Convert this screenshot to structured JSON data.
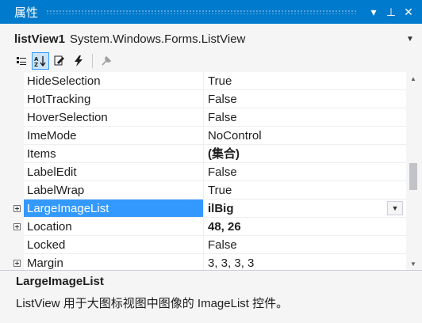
{
  "panel": {
    "title": "属性",
    "pin_glyph": "▾",
    "autohide_glyph": "⊥",
    "close_glyph": "✕"
  },
  "object_selector": {
    "name": "listView1",
    "type": "System.Windows.Forms.ListView"
  },
  "toolbar": {
    "icons": [
      "categorized-icon",
      "alphabetical-icon",
      "properties-icon",
      "events-icon",
      "property-pages-icon"
    ],
    "active": "alphabetical-icon"
  },
  "grid": {
    "rows": [
      {
        "name": "HideSelection",
        "value": "True",
        "bold": false,
        "expandable": false
      },
      {
        "name": "HotTracking",
        "value": "False",
        "bold": false,
        "expandable": false
      },
      {
        "name": "HoverSelection",
        "value": "False",
        "bold": false,
        "expandable": false
      },
      {
        "name": "ImeMode",
        "value": "NoControl",
        "bold": false,
        "expandable": false
      },
      {
        "name": "Items",
        "value": "(集合)",
        "bold": true,
        "expandable": false
      },
      {
        "name": "LabelEdit",
        "value": "False",
        "bold": false,
        "expandable": false
      },
      {
        "name": "LabelWrap",
        "value": "True",
        "bold": false,
        "expandable": false
      },
      {
        "name": "LargeImageList",
        "value": "ilBig",
        "bold": true,
        "expandable": true,
        "selected": true
      },
      {
        "name": "Location",
        "value": "48, 26",
        "bold": true,
        "expandable": true
      },
      {
        "name": "Locked",
        "value": "False",
        "bold": false,
        "expandable": false
      },
      {
        "name": "Margin",
        "value": "3, 3, 3, 3",
        "bold": false,
        "expandable": true
      }
    ]
  },
  "description": {
    "title": "LargeImageList",
    "text": "ListView 用于大图标视图中图像的 ImageList 控件。"
  },
  "colors": {
    "title_bar": "#007acc",
    "selection": "#3399ff"
  }
}
